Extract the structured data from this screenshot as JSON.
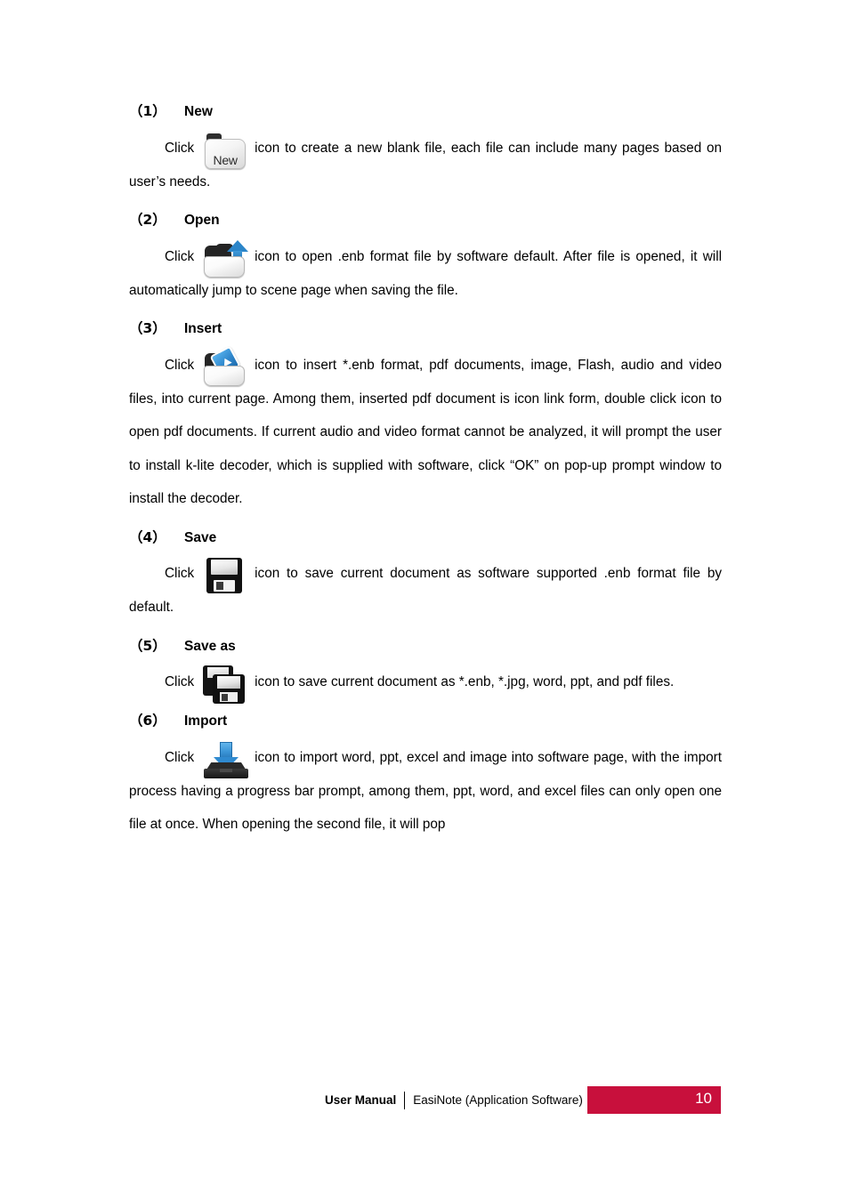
{
  "document": {
    "page_number": "10"
  },
  "sections": [
    {
      "marker": "（1）",
      "title": "New",
      "icon": "new-folder-icon",
      "icon_label": "New",
      "lead": "Click",
      "body": "icon to create a new blank file, each file can include many pages based on user’s needs."
    },
    {
      "marker": "（2）",
      "title": "Open",
      "icon": "open-folder-icon",
      "lead": "Click",
      "body": "icon to open .enb format file by software default. After file is opened, it will automatically jump to scene page when saving the file."
    },
    {
      "marker": "（3）",
      "title": "Insert",
      "icon": "insert-folder-icon",
      "lead": "Click",
      "body": "icon to insert *.enb format, pdf documents, image, Flash, audio and video files, into current page. Among them, inserted pdf document is icon link form, double click icon to open pdf documents. If current audio and video format cannot be analyzed, it will prompt the user to install k-lite decoder, which is supplied with software, click “OK” on pop-up prompt window to install the decoder."
    },
    {
      "marker": "（4）",
      "title": "Save",
      "icon": "floppy-disk-icon",
      "lead": "Click",
      "body": "icon to save current document as software supported .enb format file by default."
    },
    {
      "marker": "（5）",
      "title": "Save as",
      "icon": "floppy-disk-stack-icon",
      "lead": "Click",
      "body": "icon to save current document as *.enb, *.jpg, word, ppt, and pdf files."
    },
    {
      "marker": "（6）",
      "title": "Import",
      "icon": "import-arrow-tray-icon",
      "lead": "Click",
      "body": "icon to import word, ppt, excel and image into software page, with the import process having a progress bar prompt, among them, ppt, word, and excel files can only open one file at once. When opening the second file, it will pop"
    }
  ],
  "footer": {
    "label": "User Manual",
    "subtitle": "EasiNote (Application Software)",
    "page_number": "10",
    "badge_color": "#c8103c"
  }
}
